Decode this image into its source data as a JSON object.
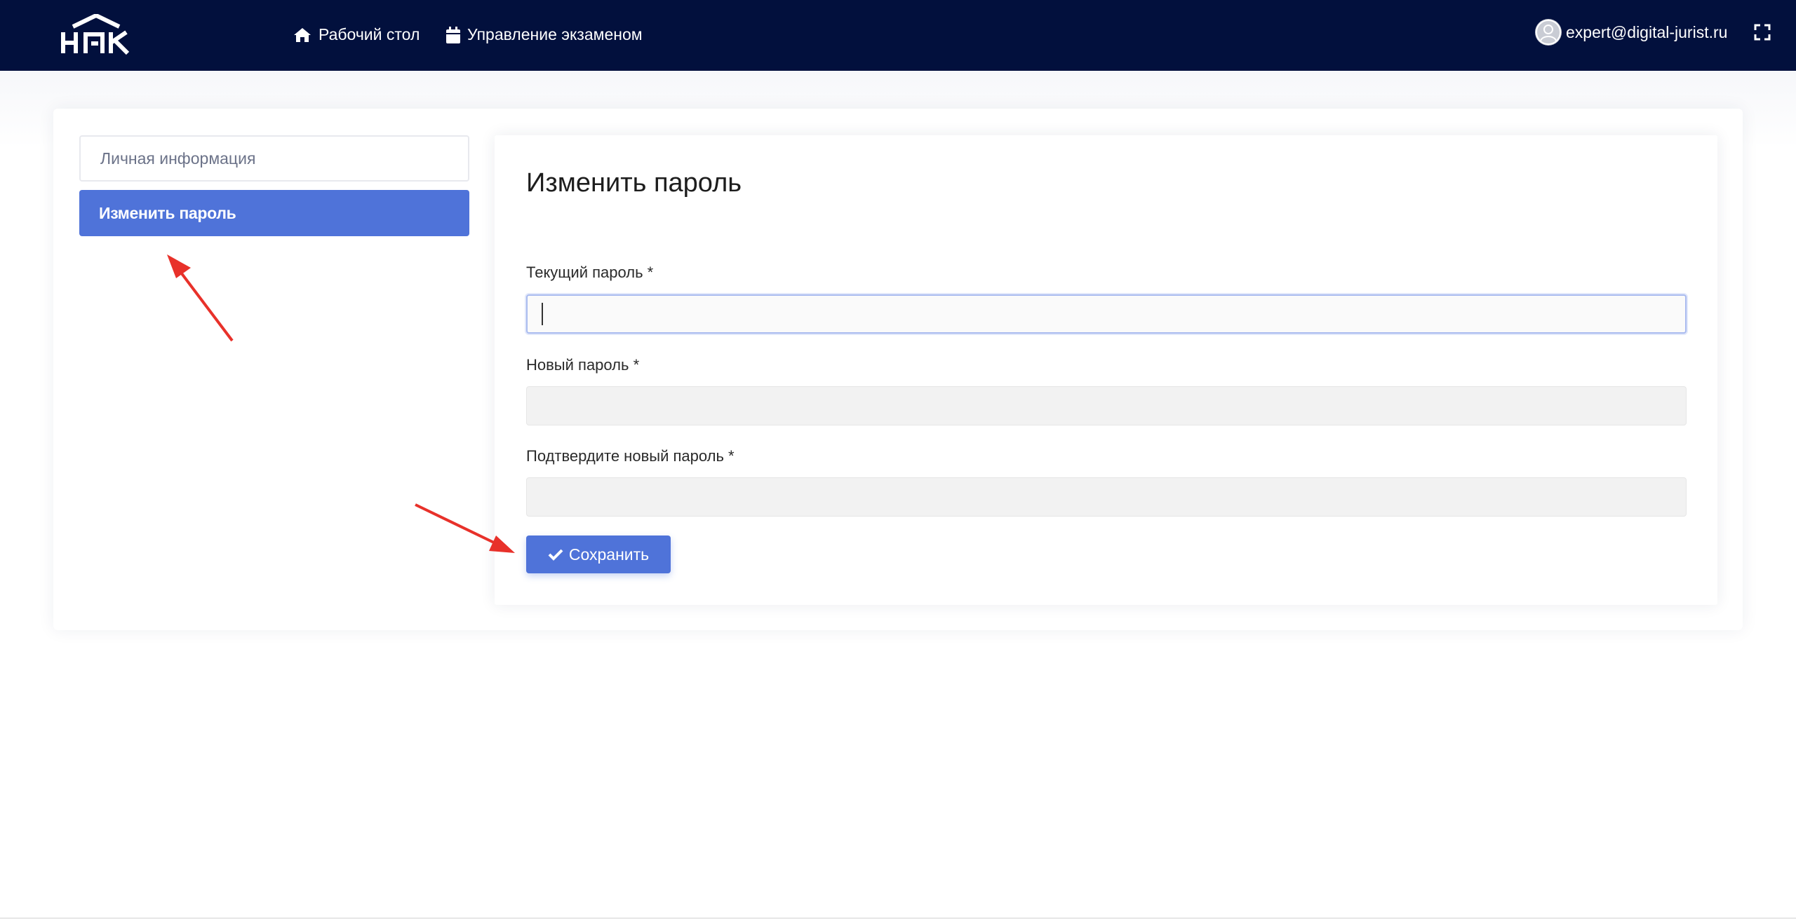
{
  "header": {
    "logo_text": "НПК",
    "nav": [
      {
        "label": "Рабочий стол",
        "icon": "home-icon"
      },
      {
        "label": "Управление экзаменом",
        "icon": "calendar-icon"
      }
    ],
    "user_email": "expert@digital-jurist.ru",
    "colors": {
      "bar": "#02103d",
      "accent": "#4f73d9"
    }
  },
  "sidebar": {
    "items": [
      {
        "label": "Личная информация",
        "active": false
      },
      {
        "label": "Изменить пароль",
        "active": true
      }
    ]
  },
  "form": {
    "title": "Изменить пароль",
    "fields": [
      {
        "label": "Текущий пароль *",
        "value": ""
      },
      {
        "label": "Новый пароль *",
        "value": ""
      },
      {
        "label": "Подтвердите новый пароль *",
        "value": ""
      }
    ],
    "save_label": "Сохранить"
  }
}
